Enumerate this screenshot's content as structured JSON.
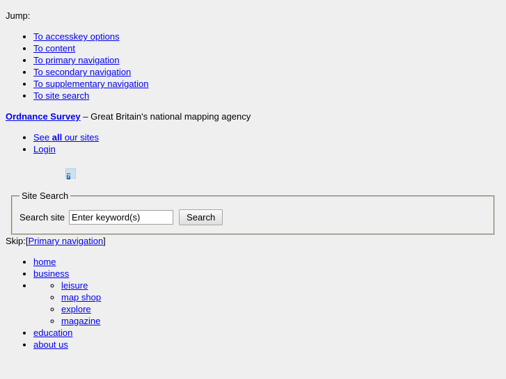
{
  "page": {
    "background_color": "#efefef",
    "link_color": "#0000ee",
    "text_color": "#000000"
  },
  "jump": {
    "label": "Jump:",
    "links": [
      "To accesskey options",
      "To content",
      "To primary navigation",
      "To secondary navigation",
      "To supplementary navigation",
      "To site search"
    ]
  },
  "branding": {
    "site_link": "Ordnance Survey",
    "tagline": " – Great Britain's national mapping agency",
    "links": [
      {
        "prefix": "See ",
        "bold": "all",
        "suffix": " our sites"
      },
      {
        "prefix": "",
        "bold": "",
        "suffix": "Login",
        "plain": "Login"
      }
    ]
  },
  "broken_image": {
    "icon": "broken-image-icon",
    "glyph": "?"
  },
  "site_search": {
    "legend": "Site Search",
    "field_label": "Search site",
    "input_value": "Enter keyword(s)",
    "input_placeholder": "Enter keyword(s)",
    "button_label": "Search"
  },
  "primary_nav": {
    "skip_prefix": "Skip:[",
    "skip_link": "Primary navigation",
    "skip_suffix": "]",
    "items": [
      {
        "label": "home",
        "children": []
      },
      {
        "label": "business",
        "children": []
      },
      {
        "label": "",
        "children": [
          "leisure",
          "map shop",
          "explore",
          "magazine"
        ]
      },
      {
        "label": "education",
        "children": []
      },
      {
        "label": "about us",
        "children": []
      }
    ]
  }
}
